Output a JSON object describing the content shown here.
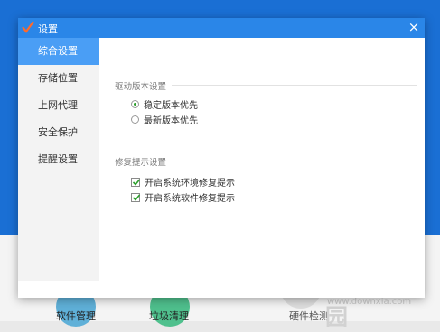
{
  "dialog": {
    "title": "设置",
    "close": "×"
  },
  "sidebar": {
    "items": [
      {
        "label": "综合设置",
        "active": true
      },
      {
        "label": "存储位置",
        "active": false
      },
      {
        "label": "上网代理",
        "active": false
      },
      {
        "label": "安全保护",
        "active": false
      },
      {
        "label": "提醒设置",
        "active": false
      }
    ]
  },
  "driver_section": {
    "title": "驱动版本设置",
    "options": [
      {
        "label": "稳定版本优先",
        "selected": true
      },
      {
        "label": "最新版本优先",
        "selected": false
      }
    ]
  },
  "repair_section": {
    "title": "修复提示设置",
    "options": [
      {
        "label": "开启系统环境修复提示",
        "checked": true
      },
      {
        "label": "开启系统软件修复提示",
        "checked": true
      }
    ]
  },
  "background": {
    "labels": [
      "软件管理",
      "垃圾清理",
      "硬件检测"
    ]
  },
  "watermark": {
    "text": "当下软件园",
    "url": "www.downxia.com"
  },
  "colors": {
    "accent": "#2a86e8",
    "sidebar_active": "#4a9ef5",
    "check_green": "#2ca02c"
  }
}
